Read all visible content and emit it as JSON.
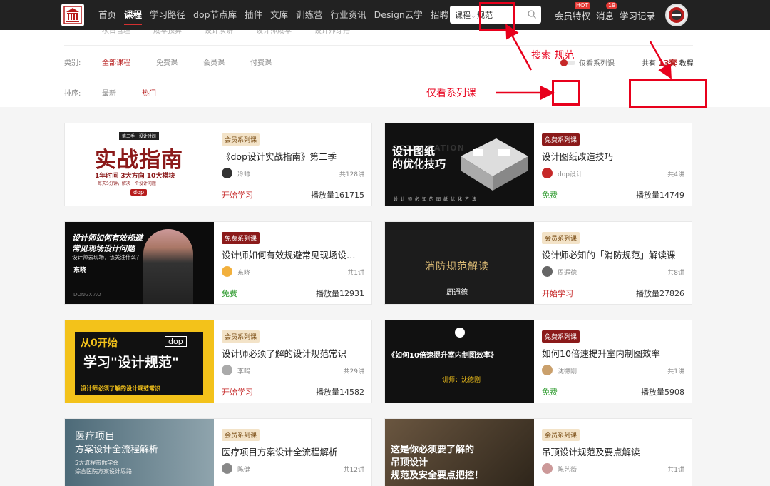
{
  "nav": {
    "items": [
      "首页",
      "课程",
      "学习路径",
      "dop节点库",
      "插件",
      "文库",
      "训练营",
      "行业资讯",
      "Design云学",
      "招聘"
    ],
    "active_index": 1
  },
  "search": {
    "category": "课程",
    "value": "规范"
  },
  "top_right": {
    "member": "会员特权",
    "member_badge": "HOT",
    "messages": "消息",
    "messages_badge": "19",
    "history": "学习记录"
  },
  "sub_strip": [
    "项目管理",
    "成本预算",
    "设计演讲",
    "设计师成本",
    "设计师穿搭"
  ],
  "filters": {
    "category": {
      "label": "类别:",
      "options": [
        "全部课程",
        "免费课",
        "会员课",
        "付费课"
      ],
      "active": 0
    },
    "sort": {
      "label": "排序:",
      "options": [
        "最新",
        "热门"
      ],
      "active": 1
    },
    "series_only_label": "仅看系列课",
    "total": {
      "prefix": "共有",
      "count": "13套",
      "suffix": "教程"
    }
  },
  "courses": [
    {
      "tag": "会员系列课",
      "tag_type": "member",
      "title": "《dop设计实战指南》第二季",
      "author": "冷帅",
      "lessons": "共128讲",
      "action": "开始学习",
      "action_type": "start",
      "plays": "播放量161715",
      "thumb": {
        "kicker": "第二季 · 设计时间",
        "big": "实战指南",
        "line1": "1年时间 3大方向 10大模块",
        "line2": "每天5分钟，解决一个设计问题",
        "brand": "dop"
      }
    },
    {
      "tag": "免费系列课",
      "tag_type": "free",
      "title": "设计图纸改造技巧",
      "author": "dop设计",
      "lessons": "共4讲",
      "action": "免费",
      "action_type": "free",
      "plays": "播放量14749",
      "thumb": {
        "small": "OPTIMIZATION",
        "line1": "设计图纸",
        "line2": "的优化技巧",
        "line3": "设计师必知的图纸优化方法"
      }
    },
    {
      "tag": "免费系列课",
      "tag_type": "free",
      "title": "设计师如何有效规避常见现场设计问题",
      "author": "东晓",
      "lessons": "共1讲",
      "action": "免费",
      "action_type": "free",
      "plays": "播放量12931",
      "thumb": {
        "line1": "设计师如何有效规避",
        "line2": "常见现场设计问题",
        "line3": "设计师去现场，该关注什么？",
        "name": "东晓",
        "en": "DONGXIAO"
      }
    },
    {
      "tag": "会员系列课",
      "tag_type": "member",
      "title": "设计师必知的「消防规范」解读课",
      "author": "周遐德",
      "lessons": "共8讲",
      "action": "开始学习",
      "action_type": "start",
      "plays": "播放量27826",
      "thumb": {
        "line1": "消防规范解读",
        "name": "周遐德"
      }
    },
    {
      "tag": "会员系列课",
      "tag_type": "member",
      "title": "设计师必须了解的设计规范常识",
      "author": "李鸣",
      "lessons": "共29讲",
      "action": "开始学习",
      "action_type": "start",
      "plays": "播放量14582",
      "thumb": {
        "line1": "从0开始",
        "line2": "学习\"设计规范\"",
        "line3": "设计师必须了解的设计规范常识",
        "brand": "dop"
      }
    },
    {
      "tag": "免费系列课",
      "tag_type": "free",
      "title": "如何10倍速提升室内制图效率",
      "author": "沈德刚",
      "lessons": "共1讲",
      "action": "免费",
      "action_type": "free",
      "plays": "播放量5908",
      "thumb": {
        "line1": "《如何10倍速提升室内制图效率》",
        "line2": "讲师：沈德刚"
      }
    },
    {
      "tag": "会员系列课",
      "tag_type": "member",
      "title": "医疗项目方案设计全流程解析",
      "author": "陈健",
      "lessons": "共12讲",
      "action": "",
      "action_type": "start",
      "plays": "",
      "thumb": {
        "line1": "医疗项目",
        "line2": "方案设计全流程解析",
        "line3": "5大流程带你学会",
        "line4": "综合医院方案设计思路"
      }
    },
    {
      "tag": "会员系列课",
      "tag_type": "member",
      "title": "吊顶设计规范及要点解读",
      "author": "陈艺薇",
      "lessons": "共1讲",
      "action": "",
      "action_type": "start",
      "plays": "",
      "thumb": {
        "line1": "这是你必须要了解的",
        "line2": "吊顶设计",
        "line3": "规范及安全要点把控！"
      }
    }
  ],
  "annotations": {
    "search": "搜索 规范",
    "series": "仅看系列课"
  },
  "colors": {
    "accent": "#c62828",
    "annotation": "#e8001c",
    "free_green": "#2e9b2e"
  }
}
